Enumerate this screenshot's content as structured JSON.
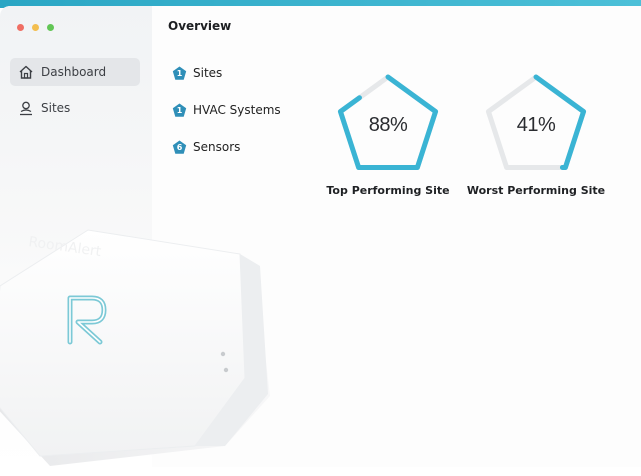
{
  "window": {
    "controls": [
      {
        "name": "close",
        "color": "#f06e63"
      },
      {
        "name": "minimize",
        "color": "#f3be4f"
      },
      {
        "name": "maximize",
        "color": "#62c655"
      }
    ]
  },
  "sidebar": {
    "items": [
      {
        "label": "Dashboard",
        "icon": "home-icon",
        "active": true
      },
      {
        "label": "Sites",
        "icon": "user-pin-icon",
        "active": false
      }
    ]
  },
  "main": {
    "title": "Overview",
    "stats": [
      {
        "label": "Sites",
        "count": "1"
      },
      {
        "label": "HVAC Systems",
        "count": "1"
      },
      {
        "label": "Sensors",
        "count": "6"
      }
    ],
    "gauges": [
      {
        "value_text": "88%",
        "value": 0.88,
        "label": "Top Performing Site"
      },
      {
        "value_text": "41%",
        "value": 0.41,
        "label": "Worst Performing Site"
      }
    ]
  },
  "colors": {
    "accent": "#3ab4d4",
    "track": "#e6e8ea",
    "badge": "#2f8fb8"
  },
  "brand": {
    "logo_letter": "R"
  }
}
